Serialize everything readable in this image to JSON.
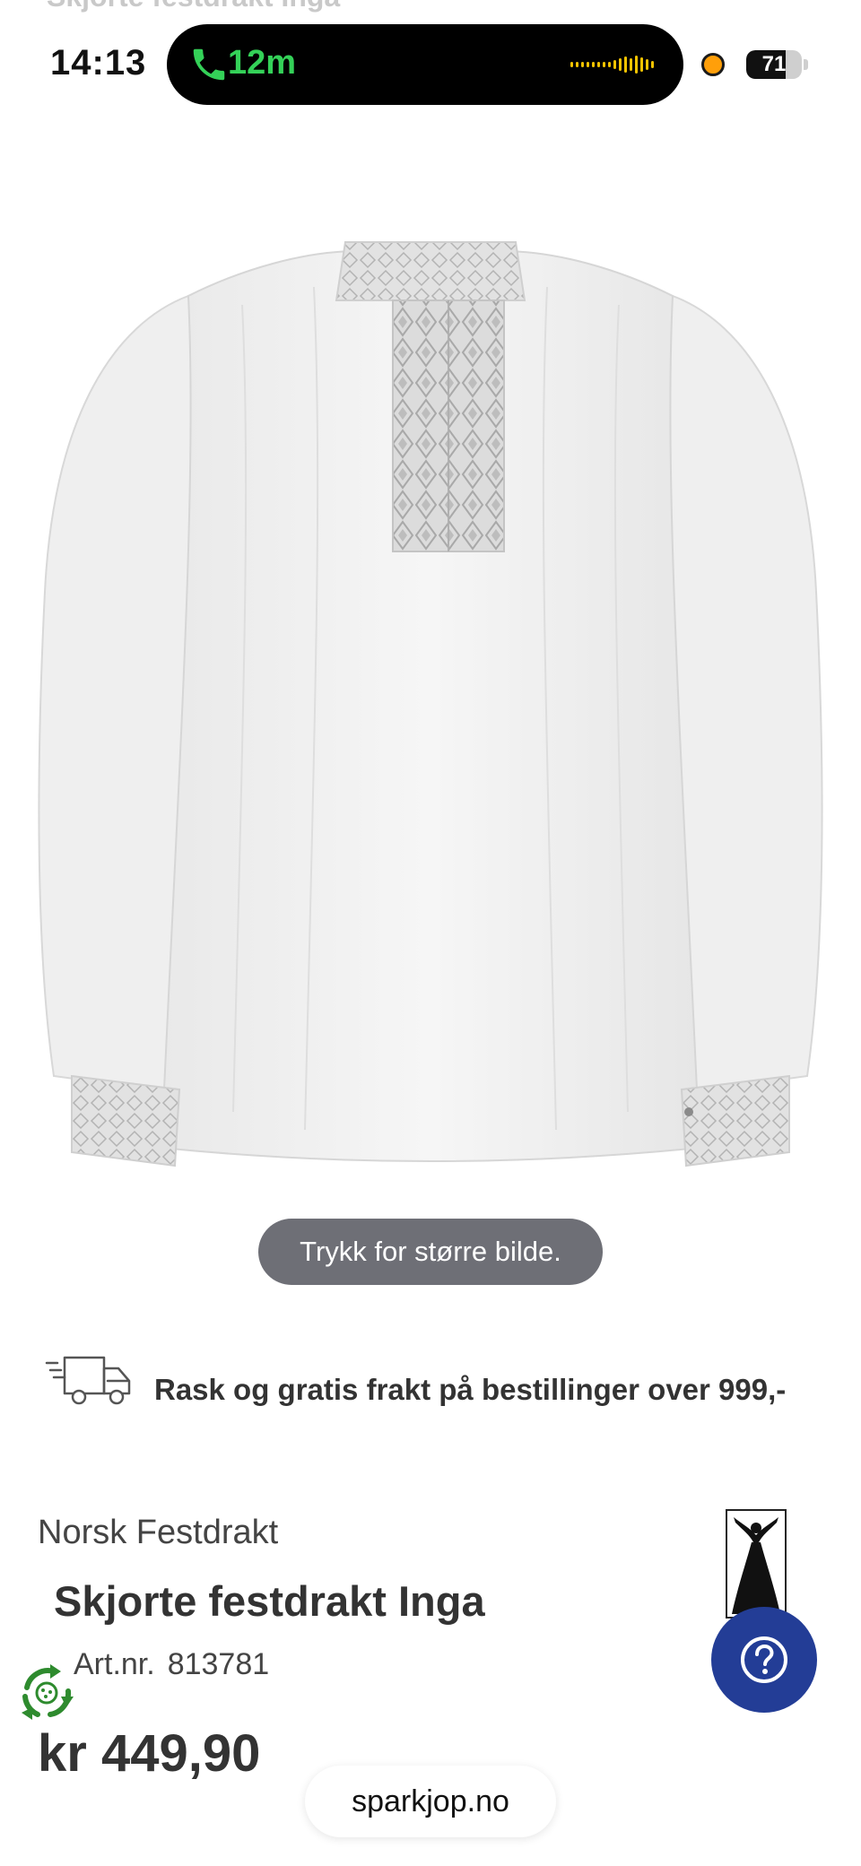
{
  "ghost_header": {
    "title": "Skjorte festdrakt Inga"
  },
  "status_bar": {
    "time": "14:13",
    "call_duration": "12m",
    "battery_level": "71",
    "battery_fraction": 0.71,
    "call_color": "#34d158",
    "indicator_color": "#ff9f0a"
  },
  "image_overlay": {
    "enlarge_hint": "Trykk for større bilde."
  },
  "shipping": {
    "icon": "delivery-truck-icon",
    "text": "Rask og gratis frakt på bestillinger over 999,-"
  },
  "product": {
    "brand": "Norsk Festdrakt",
    "title": "Skjorte festdrakt Inga",
    "article_label": "Art.nr.",
    "article_number": "813781",
    "price": "kr 449,90"
  },
  "help": {
    "icon": "question-mark-icon",
    "color": "#233d96"
  },
  "browser": {
    "url": "sparkjop.no"
  }
}
